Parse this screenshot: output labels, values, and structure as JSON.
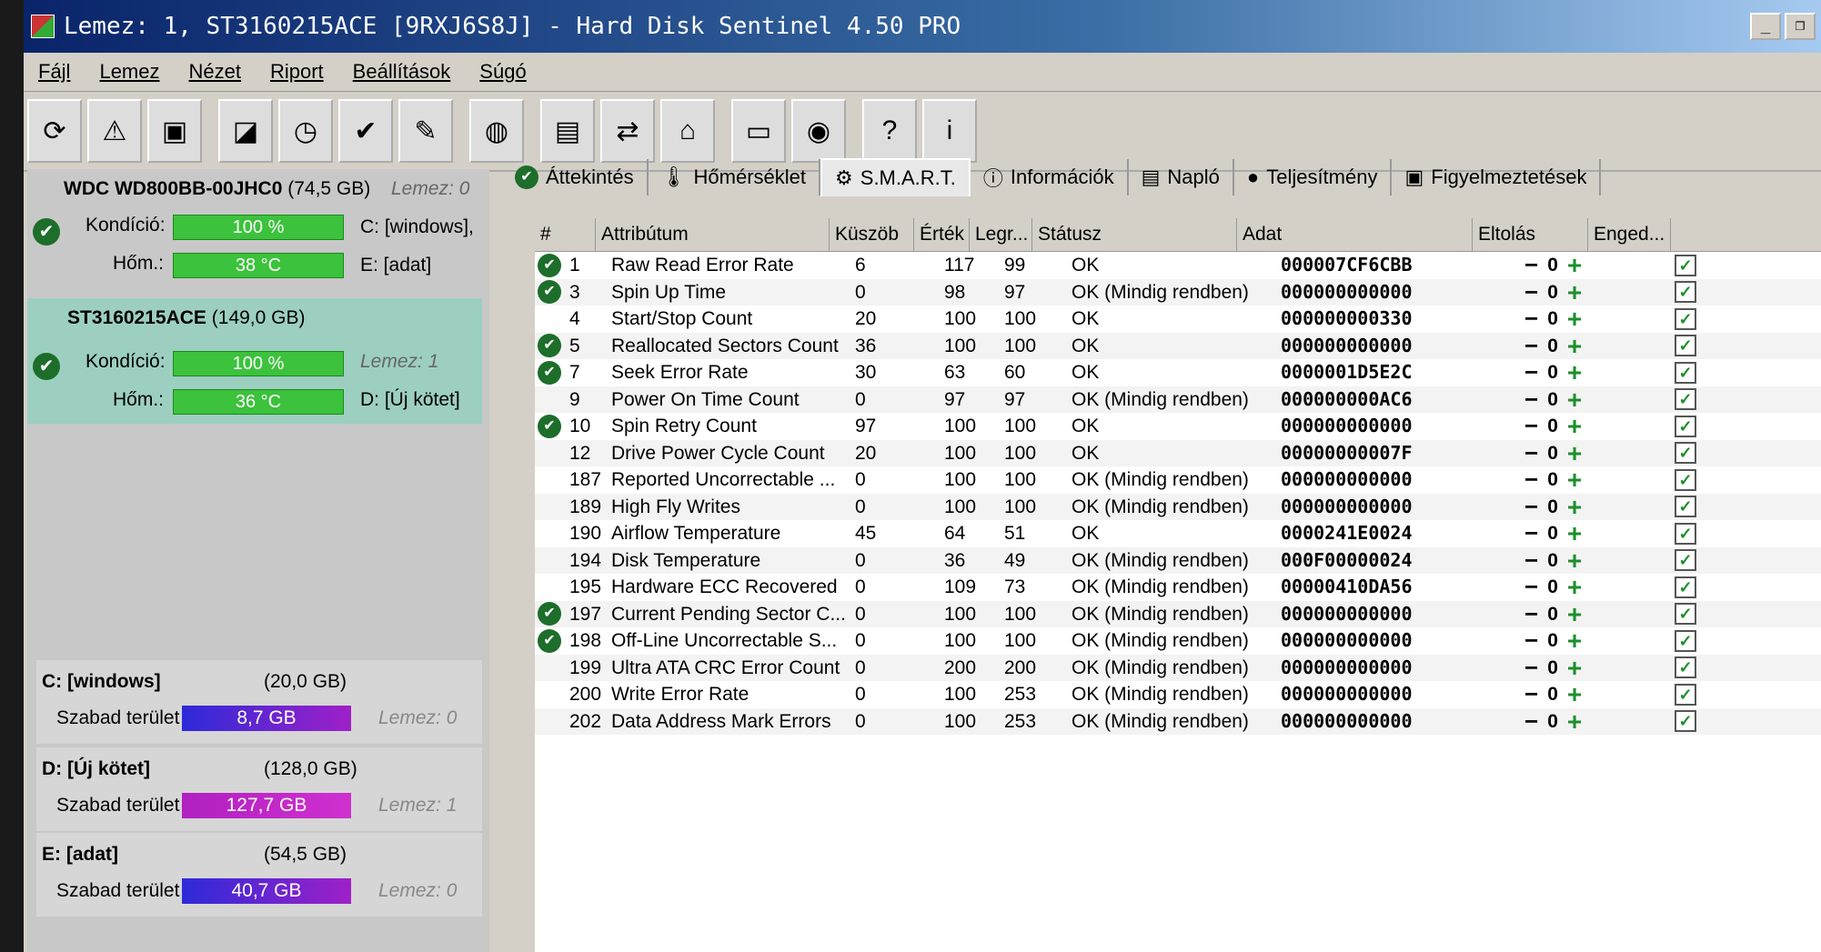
{
  "window": {
    "title": "Lemez: 1, ST3160215ACE [9RXJ6S8J] - Hard Disk Sentinel 4.50 PRO"
  },
  "menu": [
    "Fájl",
    "Lemez",
    "Nézet",
    "Riport",
    "Beállítások",
    "Súgó"
  ],
  "toolbar_icons": [
    "refresh-icon",
    "warning-icon",
    "disk-icon",
    "drive-icon",
    "drive-clock-icon",
    "drive-check-icon",
    "drive-edit-icon",
    "globe-icon",
    "document-icon",
    "sync-icon",
    "network-icon",
    "monitor-icon",
    "speaker-icon",
    "help-icon",
    "info-icon"
  ],
  "disks": [
    {
      "model": "WDC WD800BB-00JHC0",
      "size": "(74,5 GB)",
      "ref": "Lemez: 0",
      "health_label": "Kondíció:",
      "health": "100 %",
      "health_pct": 100,
      "temp_label": "Hőm.:",
      "temp": "38 °C",
      "vol1": "C: [windows],",
      "vol2": "E: [adat]"
    },
    {
      "model": "ST3160215ACE",
      "size": "(149,0 GB)",
      "ref": "Lemez: 1",
      "health_label": "Kondíció:",
      "health": "100 %",
      "health_pct": 100,
      "temp_label": "Hőm.:",
      "temp": "36 °C",
      "vol2": "D: [Új kötet]"
    }
  ],
  "volumes": [
    {
      "name": "C: [windows]",
      "size": "(20,0 GB)",
      "free_label": "Szabad terület",
      "free": "8,7 GB",
      "ref": "Lemez: 0"
    },
    {
      "name": "D: [Új kötet]",
      "size": "(128,0 GB)",
      "free_label": "Szabad terület",
      "free": "127,7 GB",
      "ref": "Lemez: 1"
    },
    {
      "name": "E: [adat]",
      "size": "(54,5 GB)",
      "free_label": "Szabad terület",
      "free": "40,7 GB",
      "ref": "Lemez: 0"
    }
  ],
  "tabs": [
    {
      "label": "Áttekintés",
      "icon": "check-circle-icon"
    },
    {
      "label": "Hőmérséklet",
      "icon": "thermometer-icon"
    },
    {
      "label": "S.M.A.R.T.",
      "icon": "smart-icon",
      "active": true
    },
    {
      "label": "Információk",
      "icon": "info-icon"
    },
    {
      "label": "Napló",
      "icon": "log-icon"
    },
    {
      "label": "Teljesítmény",
      "icon": "performance-icon"
    },
    {
      "label": "Figyelmeztetések",
      "icon": "alerts-icon"
    }
  ],
  "columns": {
    "num": "#",
    "attr": "Attribútum",
    "thr": "Küszöb",
    "val": "Érték",
    "worst": "Legr...",
    "stat": "Státusz",
    "data": "Adat",
    "off": "Eltolás",
    "en": "Enged..."
  },
  "rows": [
    {
      "ok": true,
      "num": "1",
      "attr": "Raw Read Error Rate",
      "thr": "6",
      "val": "117",
      "worst": "99",
      "stat": "OK",
      "data": "000007CF6CBB",
      "off": "0"
    },
    {
      "ok": true,
      "num": "3",
      "attr": "Spin Up Time",
      "thr": "0",
      "val": "98",
      "worst": "97",
      "stat": "OK (Mindig rendben)",
      "data": "000000000000",
      "off": "0"
    },
    {
      "ok": false,
      "num": "4",
      "attr": "Start/Stop Count",
      "thr": "20",
      "val": "100",
      "worst": "100",
      "stat": "OK",
      "data": "000000000330",
      "off": "0"
    },
    {
      "ok": true,
      "num": "5",
      "attr": "Reallocated Sectors Count",
      "thr": "36",
      "val": "100",
      "worst": "100",
      "stat": "OK",
      "data": "000000000000",
      "off": "0"
    },
    {
      "ok": true,
      "num": "7",
      "attr": "Seek Error Rate",
      "thr": "30",
      "val": "63",
      "worst": "60",
      "stat": "OK",
      "data": "0000001D5E2C",
      "off": "0"
    },
    {
      "ok": false,
      "num": "9",
      "attr": "Power On Time Count",
      "thr": "0",
      "val": "97",
      "worst": "97",
      "stat": "OK (Mindig rendben)",
      "data": "000000000AC6",
      "off": "0"
    },
    {
      "ok": true,
      "num": "10",
      "attr": "Spin Retry Count",
      "thr": "97",
      "val": "100",
      "worst": "100",
      "stat": "OK",
      "data": "000000000000",
      "off": "0"
    },
    {
      "ok": false,
      "num": "12",
      "attr": "Drive Power Cycle Count",
      "thr": "20",
      "val": "100",
      "worst": "100",
      "stat": "OK",
      "data": "00000000007F",
      "off": "0"
    },
    {
      "ok": false,
      "num": "187",
      "attr": "Reported Uncorrectable ...",
      "thr": "0",
      "val": "100",
      "worst": "100",
      "stat": "OK (Mindig rendben)",
      "data": "000000000000",
      "off": "0"
    },
    {
      "ok": false,
      "num": "189",
      "attr": "High Fly Writes",
      "thr": "0",
      "val": "100",
      "worst": "100",
      "stat": "OK (Mindig rendben)",
      "data": "000000000000",
      "off": "0"
    },
    {
      "ok": false,
      "num": "190",
      "attr": "Airflow Temperature",
      "thr": "45",
      "val": "64",
      "worst": "51",
      "stat": "OK",
      "data": "0000241E0024",
      "off": "0"
    },
    {
      "ok": false,
      "num": "194",
      "attr": "Disk Temperature",
      "thr": "0",
      "val": "36",
      "worst": "49",
      "stat": "OK (Mindig rendben)",
      "data": "000F00000024",
      "off": "0"
    },
    {
      "ok": false,
      "num": "195",
      "attr": "Hardware ECC Recovered",
      "thr": "0",
      "val": "109",
      "worst": "73",
      "stat": "OK (Mindig rendben)",
      "data": "00000410DA56",
      "off": "0"
    },
    {
      "ok": true,
      "num": "197",
      "attr": "Current Pending Sector C...",
      "thr": "0",
      "val": "100",
      "worst": "100",
      "stat": "OK (Mindig rendben)",
      "data": "000000000000",
      "off": "0"
    },
    {
      "ok": true,
      "num": "198",
      "attr": "Off-Line Uncorrectable S...",
      "thr": "0",
      "val": "100",
      "worst": "100",
      "stat": "OK (Mindig rendben)",
      "data": "000000000000",
      "off": "0"
    },
    {
      "ok": false,
      "num": "199",
      "attr": "Ultra ATA CRC Error Count",
      "thr": "0",
      "val": "200",
      "worst": "200",
      "stat": "OK (Mindig rendben)",
      "data": "000000000000",
      "off": "0"
    },
    {
      "ok": false,
      "num": "200",
      "attr": "Write Error Rate",
      "thr": "0",
      "val": "100",
      "worst": "253",
      "stat": "OK (Mindig rendben)",
      "data": "000000000000",
      "off": "0"
    },
    {
      "ok": false,
      "num": "202",
      "attr": "Data Address Mark Errors",
      "thr": "0",
      "val": "100",
      "worst": "253",
      "stat": "OK (Mindig rendben)",
      "data": "000000000000",
      "off": "0"
    }
  ]
}
